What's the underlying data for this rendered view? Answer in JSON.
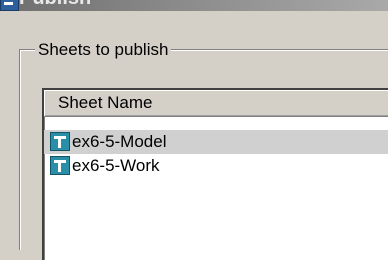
{
  "window": {
    "title": "Publish"
  },
  "group": {
    "label": "Sheets to publish"
  },
  "list": {
    "column_header": "Sheet Name",
    "rows": [
      {
        "name": "ex6-5-Model",
        "icon": "sheet-icon"
      },
      {
        "name": "ex6-5-Work",
        "icon": "sheet-icon"
      }
    ]
  }
}
